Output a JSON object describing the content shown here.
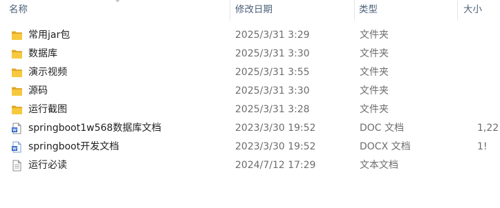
{
  "header": {
    "name": "名称",
    "date": "修改日期",
    "type": "类型",
    "size": "大小"
  },
  "files": [
    {
      "name": "常用jar包",
      "date": "2025/3/31 3:29",
      "type": "文件夹",
      "size": "",
      "icon": "folder-icon"
    },
    {
      "name": "数据库",
      "date": "2025/3/31 3:30",
      "type": "文件夹",
      "size": "",
      "icon": "folder-icon"
    },
    {
      "name": "演示视频",
      "date": "2025/3/31 3:55",
      "type": "文件夹",
      "size": "",
      "icon": "folder-icon"
    },
    {
      "name": "源码",
      "date": "2025/3/31 3:30",
      "type": "文件夹",
      "size": "",
      "icon": "folder-icon"
    },
    {
      "name": "运行截图",
      "date": "2025/3/31 3:28",
      "type": "文件夹",
      "size": "",
      "icon": "folder-icon"
    },
    {
      "name": "springboot1w568数据库文档",
      "date": "2023/3/30 19:52",
      "type": "DOC 文档",
      "size": "1,22",
      "icon": "word-doc-icon"
    },
    {
      "name": "springboot开发文档",
      "date": "2023/3/30 19:52",
      "type": "DOCX 文档",
      "size": "1!",
      "icon": "word-docx-icon"
    },
    {
      "name": "运行必读",
      "date": "2024/7/12 17:29",
      "type": "文本文档",
      "size": "",
      "icon": "text-file-icon"
    }
  ],
  "colors": {
    "folder": "#f7c93e",
    "folder_dark": "#e0a82a",
    "word": "#2b63c6",
    "header_text": "#4c607a"
  }
}
